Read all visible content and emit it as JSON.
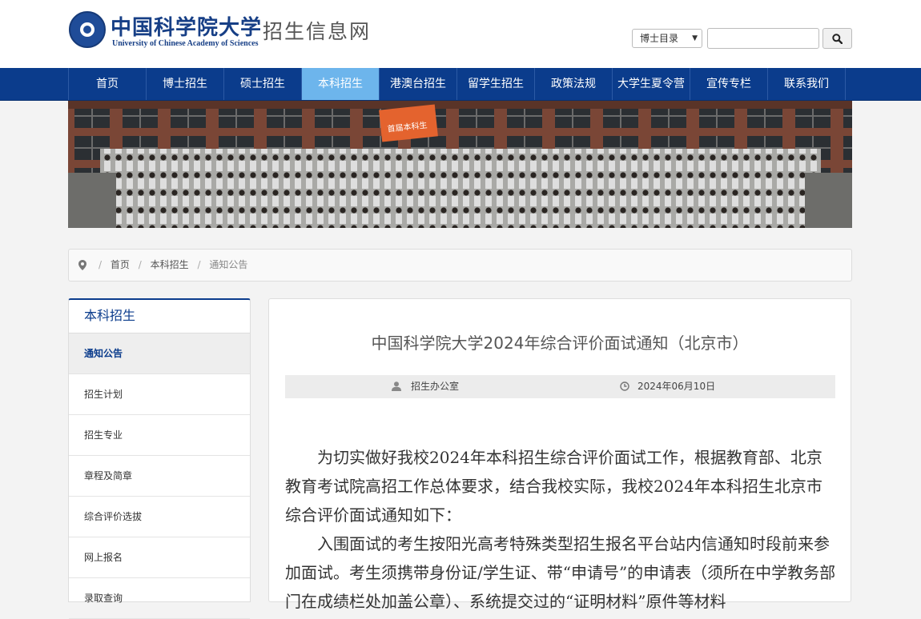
{
  "header": {
    "logo_cn": "中国科学院大学",
    "logo_en": "University of Chinese Academy of Sciences",
    "site_title": "招生信息网",
    "search_select": "博士目录",
    "search_placeholder": ""
  },
  "nav": {
    "items": [
      "首页",
      "博士招生",
      "硕士招生",
      "本科招生",
      "港澳台招生",
      "留学生招生",
      "政策法规",
      "大学生夏令营",
      "宣传专栏",
      "联系我们"
    ],
    "active_index": 3,
    "active_color": "#6db5ec",
    "bar_color": "#0b3c8c"
  },
  "breadcrumb": {
    "items": [
      "首页",
      "本科招生",
      "通知公告"
    ]
  },
  "sidebar": {
    "title": "本科招生",
    "items": [
      "通知公告",
      "招生计划",
      "招生专业",
      "章程及简章",
      "综合评价选拔",
      "网上报名",
      "录取查询"
    ],
    "active_index": 0
  },
  "article": {
    "title": "中国科学院大学2024年综合评价面试通知（北京市）",
    "author": "招生办公室",
    "date": "2024年06月10日",
    "paragraphs": [
      "为切实做好我校2024年本科招生综合评价面试工作，根据教育部、北京教育考试院高招工作总体要求，结合我校实际，我校2024年本科招生北京市综合评价面试通知如下：",
      "入围面试的考生按阳光高考特殊类型招生报名平台站内信通知时段前来参加面试。考生须携带身份证/学生证、带“申请号”的申请表（须所在中学教务部门在成绩栏处加盖公章）、系统提交过的“证明材料”原件等材料"
    ]
  },
  "banner": {
    "flag_text": "首届本科生"
  }
}
